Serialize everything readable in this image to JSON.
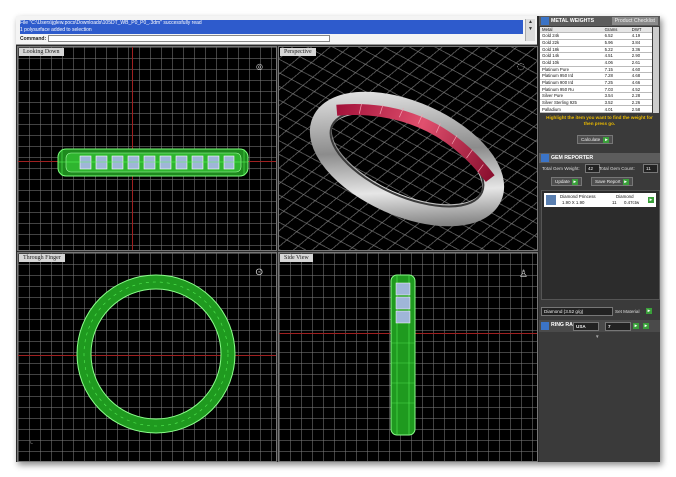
{
  "command": {
    "line1": "File \"C:\\Users\\jglew.pocs\\Downloads\\105DT_WB_P0_P0_.3dm\" successfully read",
    "line2": "1 polysurface added to selection",
    "line3": "Command:",
    "scroll_up": "▲",
    "scroll_down": "▼"
  },
  "viewports": {
    "top_left": "Looking Down",
    "top_right": "Perspective",
    "bottom_left": "Through Finger",
    "bottom_right": "Side View"
  },
  "metal_weights": {
    "title": "METAL WEIGHTS",
    "tab": "Product Checklist",
    "columns": [
      "Metal",
      "Grams",
      "DWT"
    ],
    "rows": [
      [
        "Gold 24k",
        "6.52",
        "4.19"
      ],
      [
        "Gold 22k",
        "5.96",
        "3.84"
      ],
      [
        "Gold 18k",
        "5.22",
        "3.36"
      ],
      [
        "Gold 14k",
        "4.51",
        "2.90"
      ],
      [
        "Gold 10k",
        "4.06",
        "2.61"
      ],
      [
        "Platinum Pure",
        "7.15",
        "4.60"
      ],
      [
        "Platinum 950 Ird",
        "7.28",
        "4.68"
      ],
      [
        "Platinum 900 Ird",
        "7.25",
        "4.66"
      ],
      [
        "Platinum 950 Ru",
        "7.03",
        "4.52"
      ],
      [
        "Silver Pure",
        "3.54",
        "2.28"
      ],
      [
        "Silver Sterling 925",
        "3.52",
        "2.26"
      ],
      [
        "Palladium",
        "4.01",
        "2.58"
      ]
    ],
    "hint": "Highlight the item you want to find the weight for then press go.",
    "calculate_label": "Calculate",
    "go_label": "►"
  },
  "gem_reporter": {
    "title": "GEM REPORTER",
    "total_weight_label": "Total Gem Weight:",
    "total_weight_value": "42",
    "total_count_label": "Total Gem Count:",
    "total_count_value": "11",
    "update_label": "Update",
    "save_label": "Save Report",
    "gem": {
      "name": "Diamond Princess",
      "size": "1.90 X 1.90",
      "type": "Diamond",
      "count": "11",
      "weight": "0.47ctw"
    },
    "material_value": "Diamond  (3.52 g/g)",
    "set_material_label": "Set Material"
  },
  "ring_rail": {
    "label": "RING RAIL",
    "country": "USA",
    "size": "7"
  },
  "colors": {
    "wire_green": "#44dd44",
    "viewport_bg": "#000000",
    "panel_bg": "#3a3a3a",
    "accent_blue": "#2e5bcc",
    "highlight_yellow": "#e8b800"
  }
}
